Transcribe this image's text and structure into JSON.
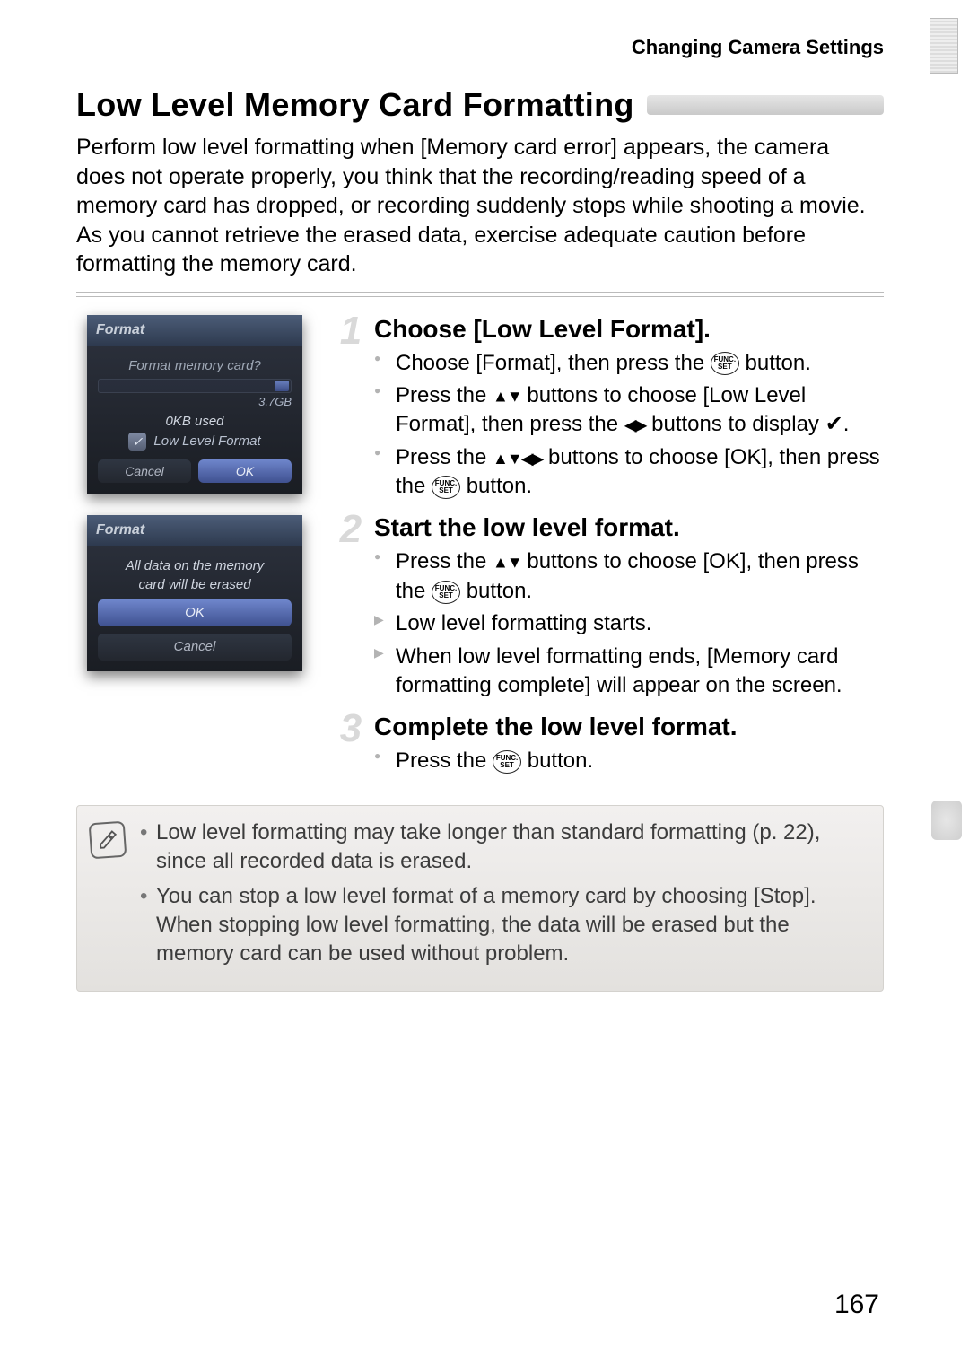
{
  "breadcrumb": "Changing Camera Settings",
  "title": "Low Level Memory Card Formatting",
  "intro": "Perform low level formatting when [Memory card error] appears, the camera does not operate properly, you think that the recording/reading speed of a memory card has dropped, or recording suddenly stops while shooting a movie. As you cannot retrieve the erased data, exercise adequate caution before formatting the memory card.",
  "func_label": "FUNC.\nSET",
  "screenshots": {
    "a": {
      "title": "Format",
      "prompt": "Format memory card?",
      "capacity": "3.7GB",
      "used": "0KB used",
      "checkbox": "✓",
      "option": "Low Level Format",
      "cancel": "Cancel",
      "ok": "OK"
    },
    "b": {
      "title": "Format",
      "line1": "All data on the memory",
      "line2": "card will be erased",
      "ok": "OK",
      "cancel": "Cancel"
    }
  },
  "steps": [
    {
      "num": "1",
      "title": "Choose [Low Level Format].",
      "items": [
        {
          "type": "dot",
          "html": "Choose [Format], then press the {FUNC} button."
        },
        {
          "type": "dot",
          "html": "Press the ▲▼ buttons to choose [Low Level Format], then press the ◀▶ buttons to display ✔."
        },
        {
          "type": "dot",
          "html": "Press the ▲▼◀▶ buttons to choose [OK], then press the {FUNC} button."
        }
      ]
    },
    {
      "num": "2",
      "title": "Start the low level format.",
      "items": [
        {
          "type": "dot",
          "html": "Press the ▲▼ buttons to choose [OK], then press the {FUNC} button."
        },
        {
          "type": "arrow",
          "html": "Low level formatting starts."
        },
        {
          "type": "arrow",
          "html": "When low level formatting ends, [Memory card formatting complete] will appear on the screen."
        }
      ]
    },
    {
      "num": "3",
      "title": "Complete the low level format.",
      "items": [
        {
          "type": "dot",
          "html": "Press the {FUNC} button."
        }
      ]
    }
  ],
  "notes": [
    "Low level formatting may take longer than standard formatting (p. 22), since all recorded data is erased.",
    "You can stop a low level format of a memory card by choosing [Stop]. When stopping low level formatting, the data will be erased but the memory card can be used without problem."
  ],
  "page_number": "167"
}
